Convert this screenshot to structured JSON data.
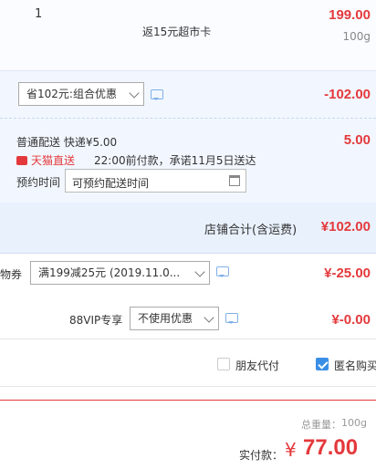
{
  "item": {
    "quantity": "1",
    "name": "返15元超市卡",
    "price": "199.00",
    "weight": "100g"
  },
  "promo": {
    "select_value": "省102元:组合优惠",
    "amount": "-102.00"
  },
  "shipping": {
    "method": "普通配送 快递¥5.00",
    "cost": "5.00",
    "badge_label": "天猫直送",
    "promise": "22:00前付款，承诺11月5日送达",
    "reserve_label": "预约时间",
    "reserve_placeholder": "可预约配送时间"
  },
  "store_total": {
    "label": "店铺合计(含运费)",
    "amount": "¥102.00"
  },
  "coupon": {
    "label": "物券",
    "select_value": "满199减25元 (2019.11.0...",
    "amount": "¥-25.00"
  },
  "vip": {
    "label": "88VIP专享",
    "select_value": "不使用优惠",
    "amount": "¥-0.00"
  },
  "options": {
    "friend_pay": "朋友代付",
    "friend_pay_checked": false,
    "anonymous": "匿名购买",
    "anonymous_checked": true
  },
  "summary": {
    "weight_label": "总重量：",
    "weight_value": "100g",
    "paid_label": "实付款：",
    "paid_currency": "¥",
    "paid_amount": "77.00"
  },
  "colors": {
    "accent_red": "#e4393c",
    "info_blue": "#f2f7ff",
    "checkbox_blue": "#3a8ee6"
  }
}
